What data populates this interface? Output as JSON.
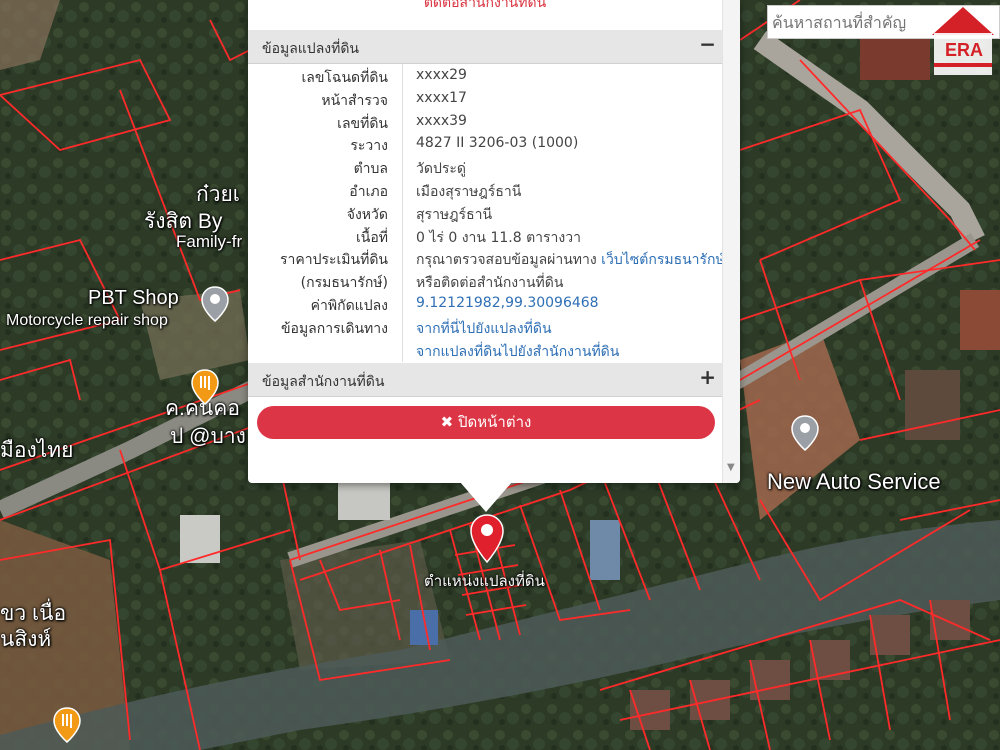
{
  "map": {
    "labels": [
      {
        "name": "label-kuaytiew",
        "text": "ก๋วยเ"
      },
      {
        "name": "label-rangsit",
        "text": "รังสิต By"
      },
      {
        "name": "label-family",
        "text": "Family-fr"
      },
      {
        "name": "label-pbt-shop",
        "text": "PBT Shop"
      },
      {
        "name": "label-motorcycle",
        "text": "Motorcycle repair shop"
      },
      {
        "name": "label-kho-nok",
        "text": "ค.คนคอ"
      },
      {
        "name": "label-pu-bang",
        "text": "ป @บาง"
      },
      {
        "name": "label-mueang-thai",
        "text": "มืองไทย"
      },
      {
        "name": "label-new-auto",
        "text": "New Auto Service"
      },
      {
        "name": "label-parcel-location",
        "text": "ตำแหน่งแปลงที่ดิน"
      },
      {
        "name": "label-khao-nuea",
        "text": "ขว เนื่อ"
      },
      {
        "name": "label-nasing",
        "text": "นสิงห์"
      }
    ]
  },
  "search": {
    "placeholder": "ค้นหาสถานที่สำคัญ"
  },
  "brand": {
    "text": "ERA",
    "color": "#d42027"
  },
  "popup": {
    "top_text": "ติดต่อสำนักงานที่ดิน",
    "section1": {
      "title": "ข้อมูลแปลงที่ดิน",
      "toggle": "−"
    },
    "rows": [
      {
        "label": "เลขโฉนดที่ดิน",
        "value": "xxxx29"
      },
      {
        "label": "หน้าสำรวจ",
        "value": "xxxx17"
      },
      {
        "label": "เลขที่ดิน",
        "value": "xxxx39"
      },
      {
        "label": "ระวาง",
        "value": "4827 II 3206-03 (1000)"
      },
      {
        "label": "ตำบล",
        "value": "วัดประดู่"
      },
      {
        "label": "อำเภอ",
        "value": "เมืองสุราษฎร์ธานี"
      },
      {
        "label": "จังหวัด",
        "value": "สุราษฎร์ธานี"
      },
      {
        "label": "เนื้อที่",
        "value": "0 ไร่ 0 งาน 11.8 ตารางวา"
      },
      {
        "label": "ราคาประเมินที่ดิน",
        "value": "กรุณาตรวจสอบข้อมูลผ่านทาง",
        "link": "เว็บไซต์กรมธนารักษ์"
      },
      {
        "label": "(กรมธนารักษ์)",
        "value": "หรือติดต่อสำนักงานที่ดิน"
      },
      {
        "label": "ค่าพิกัดแปลง",
        "link": "9.12121982,99.30096468"
      },
      {
        "label": "ข้อมูลการเดินทาง",
        "link": "จากที่นี่ไปยังแปลงที่ดิน"
      },
      {
        "label": "",
        "link": "จากแปลงที่ดินไปยังสำนักงานที่ดิน"
      }
    ],
    "section2": {
      "title": "ข้อมูลสำนักงานที่ดิน",
      "toggle": "+"
    },
    "close_label": "✖ ปิดหน้าต่าง"
  },
  "colors": {
    "boundary": "#ff2a2a",
    "accent": "#dc3545",
    "link": "#2e6fb5",
    "pin": "#e0202c"
  }
}
